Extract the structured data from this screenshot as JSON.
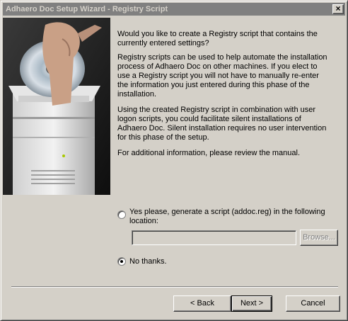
{
  "window": {
    "title": "Adhaero Doc Setup Wizard - Registry Script",
    "close_glyph": "×"
  },
  "content": {
    "paragraphs": [
      "Would you like to create a Registry script that contains the currently entered settings?",
      "Registry scripts can be used to help automate the installation process of Adhaero Doc on other machines.  If you elect to use a Registry script you will not have to manually re-enter the information you just entered during this phase of the installation.",
      "Using the created Registry script in combination with user logon scripts, you could facilitate silent installations of Adhaero Doc. Silent installation requires no user intervention for this phase of the setup.",
      "For additional information, please review the manual."
    ]
  },
  "options": {
    "yes_label": "Yes please, generate a script (addoc.reg) in the following location:",
    "yes_selected": false,
    "path_value": "",
    "browse_label": "Browse...",
    "no_label": "No thanks.",
    "no_selected": true
  },
  "buttons": {
    "back_label": "< Back",
    "next_label": "Next >",
    "cancel_label": "Cancel"
  }
}
